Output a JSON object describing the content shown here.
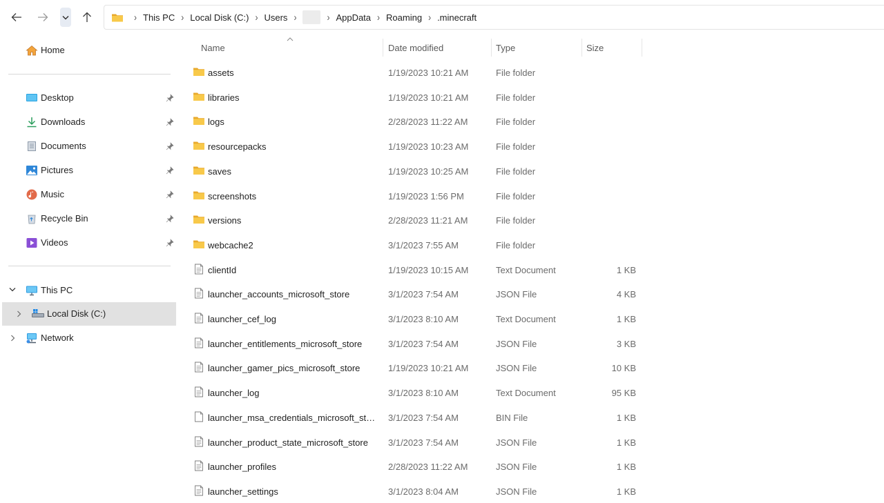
{
  "toolbar": {
    "back_icon": "arrow-left-icon",
    "forward_icon": "arrow-right-icon",
    "recent_icon": "chevron-down-icon",
    "up_icon": "arrow-up-icon"
  },
  "address_bar": {
    "crumbs": [
      "This PC",
      "Local Disk (C:)",
      "Users",
      "",
      "AppData",
      "Roaming",
      ".minecraft"
    ]
  },
  "sidebar": {
    "home": "Home",
    "quick_access": [
      {
        "label": "Desktop",
        "icon": "desktop-icon"
      },
      {
        "label": "Downloads",
        "icon": "downloads-icon"
      },
      {
        "label": "Documents",
        "icon": "documents-icon"
      },
      {
        "label": "Pictures",
        "icon": "pictures-icon"
      },
      {
        "label": "Music",
        "icon": "music-icon"
      },
      {
        "label": "Recycle Bin",
        "icon": "recycle-bin-icon"
      },
      {
        "label": "Videos",
        "icon": "videos-icon"
      }
    ],
    "this_pc": "This PC",
    "local_disk": "Local Disk (C:)",
    "network": "Network"
  },
  "columns": {
    "name": "Name",
    "date": "Date modified",
    "type": "Type",
    "size": "Size"
  },
  "files": [
    {
      "name": "assets",
      "date": "1/19/2023 10:21 AM",
      "type": "File folder",
      "size": "",
      "kind": "folder"
    },
    {
      "name": "libraries",
      "date": "1/19/2023 10:21 AM",
      "type": "File folder",
      "size": "",
      "kind": "folder"
    },
    {
      "name": "logs",
      "date": "2/28/2023 11:22 AM",
      "type": "File folder",
      "size": "",
      "kind": "folder"
    },
    {
      "name": "resourcepacks",
      "date": "1/19/2023 10:23 AM",
      "type": "File folder",
      "size": "",
      "kind": "folder"
    },
    {
      "name": "saves",
      "date": "1/19/2023 10:25 AM",
      "type": "File folder",
      "size": "",
      "kind": "folder"
    },
    {
      "name": "screenshots",
      "date": "1/19/2023 1:56 PM",
      "type": "File folder",
      "size": "",
      "kind": "folder"
    },
    {
      "name": "versions",
      "date": "2/28/2023 11:21 AM",
      "type": "File folder",
      "size": "",
      "kind": "folder"
    },
    {
      "name": "webcache2",
      "date": "3/1/2023 7:55 AM",
      "type": "File folder",
      "size": "",
      "kind": "folder"
    },
    {
      "name": "clientId",
      "date": "1/19/2023 10:15 AM",
      "type": "Text Document",
      "size": "1 KB",
      "kind": "text"
    },
    {
      "name": "launcher_accounts_microsoft_store",
      "date": "3/1/2023 7:54 AM",
      "type": "JSON File",
      "size": "4 KB",
      "kind": "text"
    },
    {
      "name": "launcher_cef_log",
      "date": "3/1/2023 8:10 AM",
      "type": "Text Document",
      "size": "1 KB",
      "kind": "text"
    },
    {
      "name": "launcher_entitlements_microsoft_store",
      "date": "3/1/2023 7:54 AM",
      "type": "JSON File",
      "size": "3 KB",
      "kind": "text"
    },
    {
      "name": "launcher_gamer_pics_microsoft_store",
      "date": "1/19/2023 10:21 AM",
      "type": "JSON File",
      "size": "10 KB",
      "kind": "text"
    },
    {
      "name": "launcher_log",
      "date": "3/1/2023 8:10 AM",
      "type": "Text Document",
      "size": "95 KB",
      "kind": "text"
    },
    {
      "name": "launcher_msa_credentials_microsoft_stor...",
      "date": "3/1/2023 7:54 AM",
      "type": "BIN File",
      "size": "1 KB",
      "kind": "blank"
    },
    {
      "name": "launcher_product_state_microsoft_store",
      "date": "3/1/2023 7:54 AM",
      "type": "JSON File",
      "size": "1 KB",
      "kind": "text"
    },
    {
      "name": "launcher_profiles",
      "date": "2/28/2023 11:22 AM",
      "type": "JSON File",
      "size": "1 KB",
      "kind": "text"
    },
    {
      "name": "launcher_settings",
      "date": "3/1/2023 8:04 AM",
      "type": "JSON File",
      "size": "1 KB",
      "kind": "text"
    }
  ],
  "colors": {
    "folder": "#f8c94a",
    "folder_dark": "#e8a92c",
    "selected_bg": "#e1e1e1",
    "accent": "#0067c0"
  }
}
